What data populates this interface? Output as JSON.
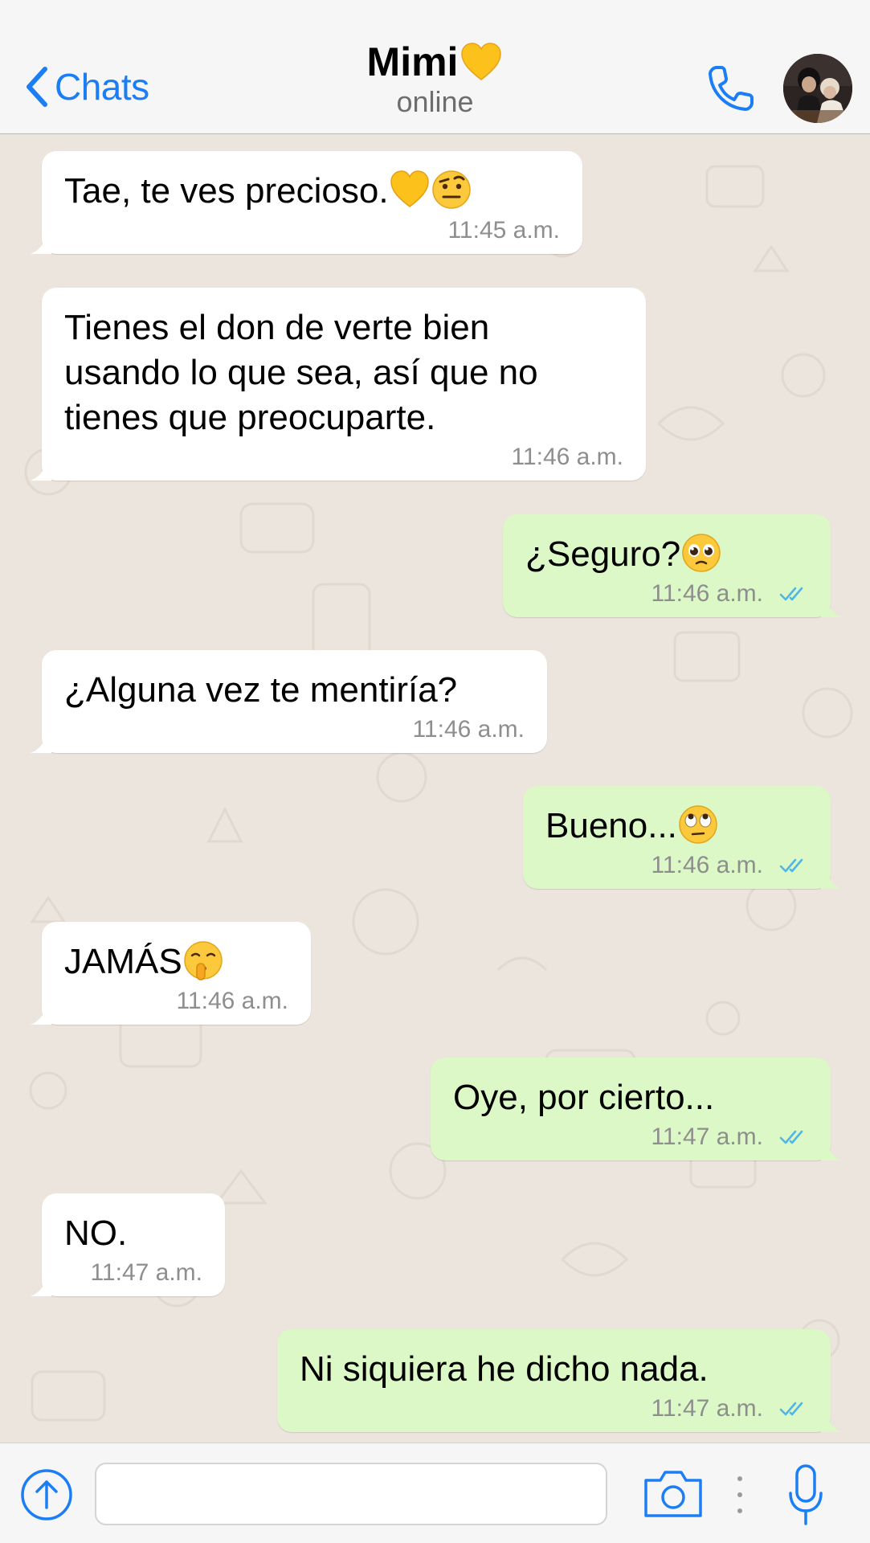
{
  "header": {
    "back_label": "Chats",
    "contact_name": "Mimi",
    "status": "online"
  },
  "messages": [
    {
      "direction": "in",
      "text": "Tae, te ves precioso.",
      "emojis": [
        "yellow-heart",
        "raised-eyebrow-face"
      ],
      "time": "11:45 a.m."
    },
    {
      "direction": "in",
      "text": "Tienes el don de verte bien\nusando lo que sea, así que no\ntienes que preocuparte.",
      "emojis": [],
      "time": "11:46 a.m."
    },
    {
      "direction": "out",
      "text": "¿Seguro?",
      "emojis": [
        "pleading-face"
      ],
      "time": "11:46 a.m.",
      "read": true
    },
    {
      "direction": "in",
      "text": "¿Alguna vez te mentiría?",
      "emojis": [],
      "time": "11:46 a.m."
    },
    {
      "direction": "out",
      "text": "Bueno...",
      "emojis": [
        "eye-roll-face"
      ],
      "time": "11:46 a.m.",
      "read": true
    },
    {
      "direction": "in",
      "text": "JAMÁS",
      "emojis": [
        "shushing-face"
      ],
      "time": "11:46 a.m."
    },
    {
      "direction": "out",
      "text": "Oye, por cierto...",
      "emojis": [],
      "time": "11:47 a.m.",
      "read": true
    },
    {
      "direction": "in",
      "text": "NO.",
      "emojis": [],
      "time": "11:47 a.m."
    },
    {
      "direction": "out",
      "text": "Ni siquiera he dicho nada.",
      "emojis": [],
      "time": "11:47 a.m.",
      "read": true
    }
  ],
  "input": {
    "value": "",
    "placeholder": ""
  },
  "colors": {
    "accent": "#1b7ef5",
    "outgoing_bubble": "#dcf8c6",
    "incoming_bubble": "#ffffff",
    "read_ticks": "#4fb6ec",
    "wallpaper": "#ece5dd"
  }
}
